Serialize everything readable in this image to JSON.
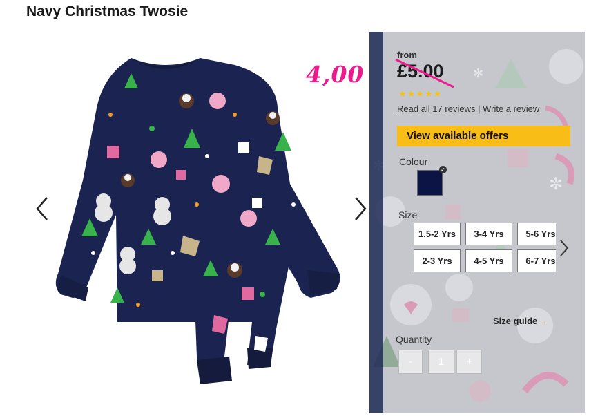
{
  "product": {
    "title": "Navy Christmas Twosie",
    "from_label": "from",
    "price": "£5.00",
    "handwritten_note": "4,00",
    "stars": "★★★★★",
    "reviews_link": "Read all 17 reviews",
    "review_separator": "|",
    "write_review_link": "Write a review",
    "offers_button": "View available offers",
    "colour_label": "Colour",
    "colour_value": "#0c1446",
    "size_label": "Size",
    "sizes": [
      "1.5-2 Yrs",
      "3-4 Yrs",
      "5-6 Yrs",
      "2-3 Yrs",
      "4-5 Yrs",
      "6-7 Yrs"
    ],
    "size_guide": "Size guide",
    "size_guide_arrow": "→",
    "quantity_label": "Quantity",
    "quantity_minus": "-",
    "quantity_value": "1",
    "quantity_plus": "+"
  },
  "colors": {
    "accent_offers": "#f9bd18",
    "handwriting": "#ec1a8c",
    "swatch_navy": "#0c1446"
  },
  "icons": {
    "gallery_prev": "chevron-left-icon",
    "gallery_next": "chevron-right-icon",
    "size_next": "chevron-right-icon",
    "swatch_selected": "checkmark-icon"
  }
}
